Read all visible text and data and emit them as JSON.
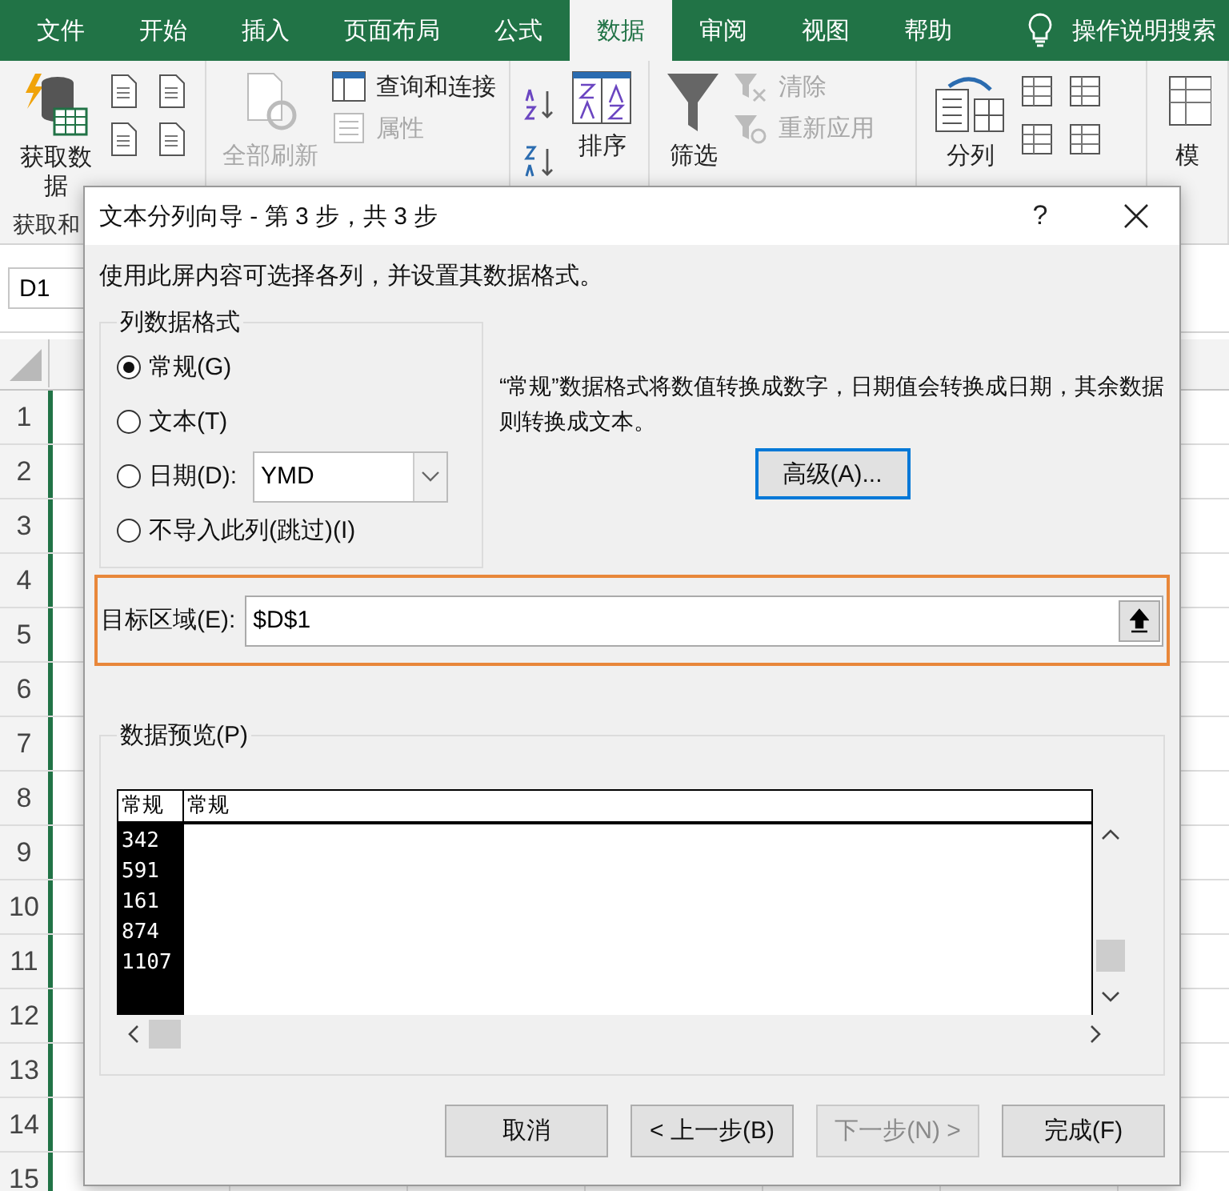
{
  "ribbon": {
    "tabs": [
      {
        "label": "文件",
        "selected": false
      },
      {
        "label": "开始",
        "selected": false
      },
      {
        "label": "插入",
        "selected": false
      },
      {
        "label": "页面布局",
        "selected": false
      },
      {
        "label": "公式",
        "selected": false
      },
      {
        "label": "数据",
        "selected": true
      },
      {
        "label": "审阅",
        "selected": false
      },
      {
        "label": "视图",
        "selected": false
      },
      {
        "label": "帮助",
        "selected": false
      }
    ],
    "search_hint": "操作说明搜索",
    "get_data": "获取数据",
    "refresh_all": {
      "label": "全部刷新",
      "disabled": true
    },
    "queries": {
      "label": "查询和连接",
      "disabled": false
    },
    "properties": {
      "label": "属性",
      "disabled": true
    },
    "sort": "排序",
    "filter": "筛选",
    "clear": {
      "label": "清除",
      "disabled": true
    },
    "reapply": {
      "label": "重新应用",
      "disabled": true
    },
    "text_to_columns": "分列",
    "cut_button": "模",
    "group_label": "获取和"
  },
  "name_box": "D1",
  "row_numbers": [
    "1",
    "2",
    "3",
    "4",
    "5",
    "6",
    "7",
    "8",
    "9",
    "10",
    "11",
    "12",
    "13",
    "14",
    "15"
  ],
  "dialog": {
    "title": "文本分列向导 - 第 3 步，共 3 步",
    "help": "?",
    "instruction": "使用此屏内容可选择各列，并设置其数据格式。",
    "format_group": "列数据格式",
    "formats": [
      {
        "label": "常规(G)",
        "selected": true
      },
      {
        "label": "文本(T)",
        "selected": false
      },
      {
        "label": "日期(D):",
        "selected": false
      },
      {
        "label": "不导入此列(跳过)(I)",
        "selected": false
      }
    ],
    "date_order": "YMD",
    "description": "“常规”数据格式将数值转换成数字，日期值会转换成日期，其余数据则转换成文本。",
    "advanced_button": "高级(A)...",
    "target": {
      "label": "目标区域(E):",
      "value": "$D$1",
      "highlighted": true
    },
    "preview_label": "数据预览(P)",
    "preview_columns": [
      {
        "header": "常规",
        "selected": true,
        "values": [
          "342",
          "591",
          "161",
          "874",
          "1107"
        ]
      },
      {
        "header": "常规",
        "selected": false
      }
    ],
    "buttons": [
      {
        "label": "取消",
        "disabled": false
      },
      {
        "label": "< 上一步(B)",
        "disabled": false
      },
      {
        "label": "下一步(N) >",
        "disabled": true
      },
      {
        "label": "完成(F)",
        "disabled": false
      }
    ]
  }
}
